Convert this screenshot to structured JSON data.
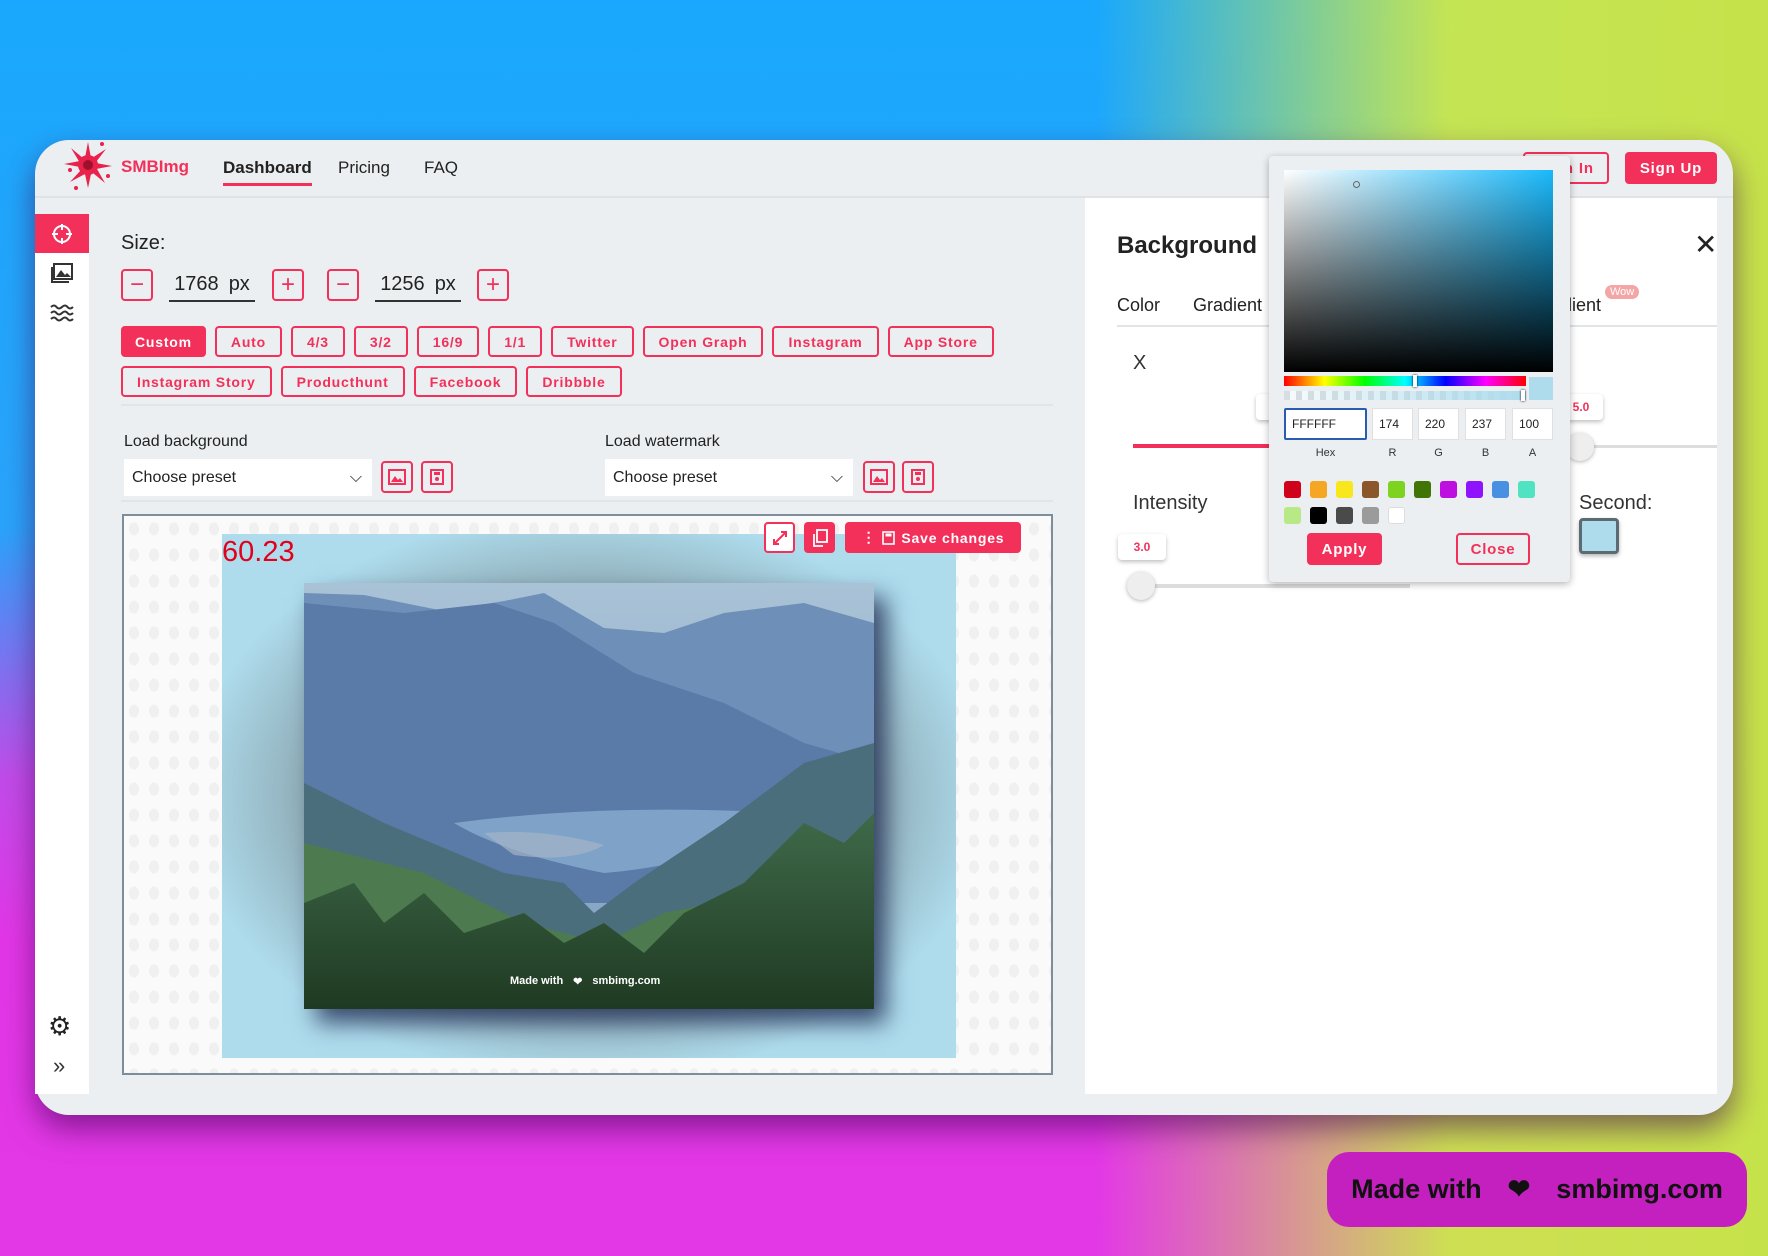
{
  "header": {
    "brand": "SMBImg",
    "nav": [
      {
        "label": "Dashboard",
        "active": true
      },
      {
        "label": "Pricing"
      },
      {
        "label": "FAQ"
      }
    ],
    "sign_in": "Sign In",
    "sign_up": "Sign Up"
  },
  "sidebar": {
    "items": [
      {
        "icon": "crosshair-icon",
        "active": true
      },
      {
        "icon": "image-icon"
      },
      {
        "icon": "waves-icon"
      }
    ],
    "bottom": [
      {
        "icon": "gear-icon"
      },
      {
        "icon": "chevrons-right-icon"
      }
    ]
  },
  "size": {
    "label": "Size:",
    "width": "1768",
    "height": "1256",
    "unit": "px"
  },
  "presets": [
    "Custom",
    "Auto",
    "4/3",
    "3/2",
    "16/9",
    "1/1",
    "Twitter",
    "Open Graph",
    "Instagram",
    "App Store",
    "Instagram Story",
    "Producthunt",
    "Facebook",
    "Dribbble"
  ],
  "active_preset": "Custom",
  "load_background": {
    "label": "Load background",
    "value": "Choose preset"
  },
  "load_watermark": {
    "label": "Load watermark",
    "value": "Choose preset"
  },
  "canvas": {
    "fps": "60.23",
    "save_label": "Save changes",
    "watermark_left": "Made with",
    "watermark_heart": "❤",
    "watermark_right": "smbimg.com",
    "bg_color": "#aedced"
  },
  "panel": {
    "title": "Background",
    "tabs": [
      "Color",
      "Gradient",
      "Gradient"
    ],
    "wow_badge": "Wow",
    "x_label": "X",
    "x_value": "5.0",
    "intensity_label": "Intensity",
    "intensity_value": "3.0",
    "second_label": "Second:",
    "second_color": "#aedced"
  },
  "color_picker": {
    "hex": "FFFFFF",
    "r": "174",
    "g": "220",
    "b": "237",
    "a": "100",
    "labels": [
      "Hex",
      "R",
      "G",
      "B",
      "A"
    ],
    "swatches": [
      "#d0021b",
      "#f5a623",
      "#f8e71c",
      "#8b572a",
      "#7ed321",
      "#417505",
      "#bd10e0",
      "#9013fe",
      "#4a90e2",
      "#50e3c2",
      "#b8e986",
      "#000000",
      "#4a4a4a",
      "#9b9b9b",
      "#ffffff"
    ],
    "apply": "Apply",
    "close": "Close"
  },
  "footer_badge": {
    "left": "Made with",
    "heart": "❤",
    "right": "smbimg.com"
  },
  "colors": {
    "accent": "#f2305a"
  }
}
